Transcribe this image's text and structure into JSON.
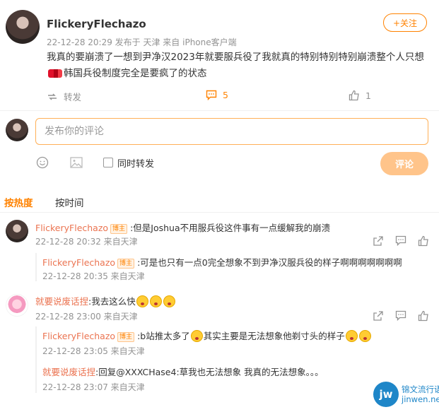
{
  "post": {
    "author": "FlickeryFlechazo",
    "meta": "22-12-28 20:29  发布于 天津  来自 iPhone客户端",
    "follow_label": "+关注",
    "text_part1": "我真的要崩溃了一想到尹净汉2023年就要服兵役了我就真的特别特别特别崩溃整个人只想",
    "text_part2": "韩国兵役制度完全是要疯了的状态",
    "repost_label": "转发",
    "comment_count": "5",
    "like_count": "1"
  },
  "compose": {
    "placeholder": "发布你的评论",
    "repost_check_label": "同时转发",
    "submit_label": "评论"
  },
  "tabs": [
    "按热度",
    "按时间"
  ],
  "comments": [
    {
      "name": "FlickeryFlechazo",
      "tag": "博主",
      "text": ":但是Joshua不用服兵役这件事有一点缓解我的崩溃",
      "meta": "22-12-28 20:32  来自天津",
      "replies": [
        {
          "name": "FlickeryFlechazo",
          "tag": "博主",
          "text": ":可是也只有一点0完全想象不到尹净汉服兵役的样子啊啊啊啊啊啊啊",
          "meta": "22-12-28 20:35  来自天津"
        }
      ]
    },
    {
      "name": "就要说废话捏",
      "text": ":我去这么快",
      "meta": "22-12-28 23:00  来自天津",
      "replies": [
        {
          "name": "FlickeryFlechazo",
          "tag": "博主",
          "text": ":b站推太多了",
          "text2": "其实主要是无法想象他剃寸头的样子",
          "meta": "22-12-28 23:05  来自天津"
        },
        {
          "name": "就要说废话捏",
          "text": ":回复@XXXCHase4:草我也无法想象 我真的无法想象。。。",
          "meta": "22-12-28 23:07  来自天津"
        }
      ]
    }
  ],
  "watermark": {
    "logo": "jw",
    "line1": "锦文流行语",
    "line2": "jinwen.net"
  },
  "colors": {
    "accent": "#ff8200",
    "name": "#eb7350",
    "muted": "#939393",
    "watermark": "#1e86c8"
  }
}
